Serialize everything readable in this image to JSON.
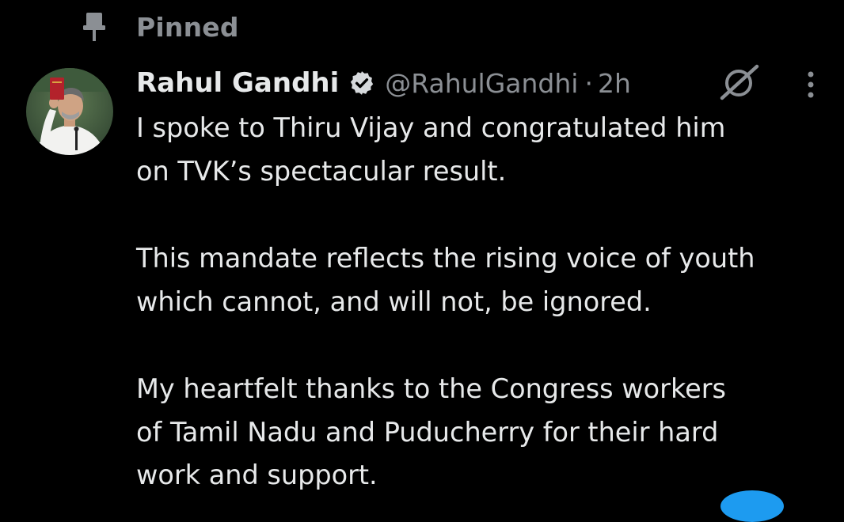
{
  "pinned": {
    "icon": "pin-icon",
    "label": "Pinned"
  },
  "author": {
    "avatar_icon": "avatar",
    "display_name": "Rahul Gandhi",
    "verified_icon": "verified-badge-icon",
    "handle": "@RahulGandhi",
    "separator": "·",
    "timestamp": "2h"
  },
  "actions": {
    "grok_icon": "grok-icon",
    "more_icon": "more-vertical-icon"
  },
  "tweet": {
    "paragraphs": [
      "I spoke to Thiru Vijay and congratulated him\non TVK’s spectacular result.",
      "This mandate reflects the rising voice of youth\nwhich cannot, and will not, be ignored.",
      "My heartfelt thanks to the Congress workers\nof Tamil Nadu and Puducherry for their hard\nwork and support."
    ]
  },
  "colors": {
    "background": "#000000",
    "primary_text": "#e7e9ea",
    "secondary_text": "#8b8f94",
    "accent": "#1d9bf0"
  }
}
